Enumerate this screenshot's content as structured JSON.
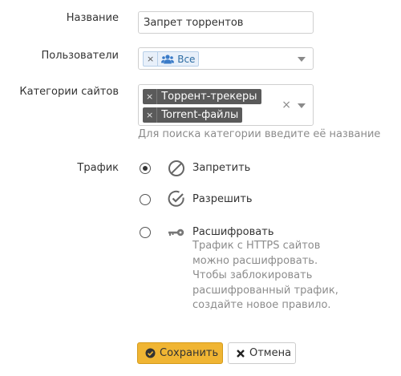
{
  "form": {
    "name_label": "Название",
    "name_value": "Запрет торрентов",
    "users_label": "Пользователи",
    "users_selected": [
      {
        "remove": "×",
        "label": "Все",
        "icon": "users-icon"
      }
    ],
    "categories_label": "Категории сайтов",
    "categories_selected": [
      {
        "remove": "×",
        "label": "Торрент-трекеры"
      },
      {
        "remove": "×",
        "label": "Torrent-файлы"
      }
    ],
    "categories_clear": "×",
    "categories_hint": "Для поиска категории введите её название",
    "traffic_label": "Трафик",
    "traffic_options": [
      {
        "label": "Запретить",
        "icon": "block-icon",
        "checked": true
      },
      {
        "label": "Разрешить",
        "icon": "check-circle-icon",
        "checked": false
      },
      {
        "label": "Расшифровать",
        "icon": "key-icon",
        "checked": false,
        "description": "Трафик с HTTPS сайтов можно расшифровать. Чтобы заблокировать расшифрованный трафик, создайте новое правило."
      }
    ]
  },
  "buttons": {
    "save": "Сохранить",
    "cancel": "Отмена"
  },
  "colors": {
    "save_bg": "#f0b533",
    "tag_dark_bg": "#5a5a5a",
    "tag_blue_bg": "#e8f0fa",
    "hint_text": "#8c8c8c"
  }
}
